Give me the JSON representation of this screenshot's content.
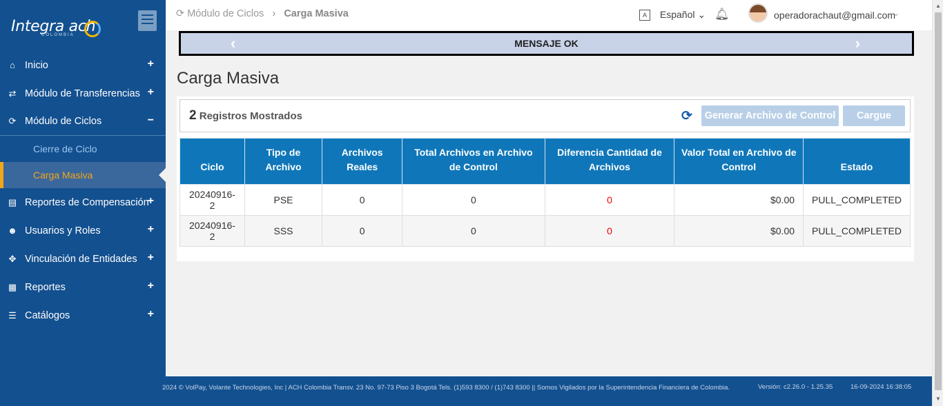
{
  "brand": {
    "name": "Integra ach",
    "sub": "COLOMBIA"
  },
  "breadcrumb": {
    "parent": "Módulo de Ciclos",
    "current": "Carga Masiva"
  },
  "header": {
    "language": "Español",
    "user": "operadorachaut@gmail.com"
  },
  "banner": {
    "message": "MENSAJE OK"
  },
  "sidebar": {
    "items": [
      {
        "label": "Inicio",
        "icon": "home-icon",
        "toggle": "+"
      },
      {
        "label": "Módulo de Transferencias",
        "icon": "exchange-icon",
        "toggle": "+"
      },
      {
        "label": "Módulo de Ciclos",
        "icon": "refresh-icon",
        "toggle": "−"
      },
      {
        "label": "Reportes de Compensación",
        "icon": "file-icon",
        "toggle": "+"
      },
      {
        "label": "Usuarios y Roles",
        "icon": "users-icon",
        "toggle": "+"
      },
      {
        "label": "Vinculación de Entidades",
        "icon": "crosshair-icon",
        "toggle": "+"
      },
      {
        "label": "Reportes",
        "icon": "report-icon",
        "toggle": "+"
      },
      {
        "label": "Catálogos",
        "icon": "list-icon",
        "toggle": "+"
      }
    ],
    "subitems": [
      "Cierre de Ciclo",
      "Carga Masiva"
    ]
  },
  "page": {
    "title": "Carga Masiva"
  },
  "records": {
    "count": "2",
    "label": "Registros Mostrados"
  },
  "buttons": {
    "generate": "Generar Archivo de Control",
    "load": "Cargue"
  },
  "table": {
    "headers": [
      "Ciclo",
      "Tipo de Archivo",
      "Archivos Reales",
      "Total Archivos en Archivo de Control",
      "Diferencia Cantidad de Archivos",
      "Valor Total en Archivo de Control",
      "Estado"
    ],
    "rows": [
      [
        "20240916-2",
        "PSE",
        "0",
        "0",
        "0",
        "$0.00",
        "PULL_COMPLETED"
      ],
      [
        "20240916-2",
        "SSS",
        "0",
        "0",
        "0",
        "$0.00",
        "PULL_COMPLETED"
      ]
    ]
  },
  "footer": {
    "text": "2024 © VolPay, Volante Technologies, Inc | ACH Colombia Transv. 23 No. 97-73 Piso 3 Bogotá Tels. (1)593 8300 / (1)743 8300 || Somos Vigilados por la Superintendencia Financiera de Colombia.",
    "version": "Versión: c2.26.0 - 1.25.35",
    "datetime": "16-09-2024 16:38:05"
  }
}
